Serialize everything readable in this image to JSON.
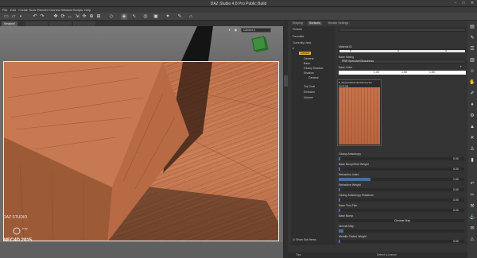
{
  "app": {
    "title": "DAZ Studio 4.8 Pro Public Build"
  },
  "menu": [
    "File",
    "Edit",
    "Create",
    "Tools",
    "Render",
    "Connect",
    "Window",
    "Scripts",
    "Help"
  ],
  "window_controls": [
    "minimize-icon",
    "maximize-icon",
    "close-icon"
  ],
  "toolbar": {
    "tools": [
      "new-icon",
      "open-icon",
      "save-icon",
      "undo-icon",
      "redo-icon",
      "pointer-icon",
      "universal-icon",
      "rotate-icon",
      "translate-icon",
      "scale-icon",
      "geometry-icon",
      "joint-icon",
      "node-icon",
      "region-icon",
      "surface-icon",
      "render-icon",
      "iray-icon",
      "spot-render-icon",
      "camera-icon",
      "light-icon"
    ]
  },
  "viewport": {
    "tab": "Viewport",
    "other_tabs": [
      "",
      "",
      ""
    ],
    "camera": "Camera 1",
    "logo": {
      "line1": "DAZ STUDIO",
      "line2": "",
      "iray": "Iray",
      "edition": "MEC4D 2015"
    }
  },
  "surfaces_panel": {
    "tabs": [
      "Shaping",
      "Surfaces",
      "Render Settings"
    ],
    "tree": {
      "items": [
        {
          "label": "Presets"
        },
        {
          "label": "Favorites"
        },
        {
          "label": "Currently Used"
        },
        {
          "label": "",
          "selected": false
        },
        {
          "label": "Default",
          "selected": true
        },
        {
          "label": "General"
        },
        {
          "label": "Base"
        },
        {
          "label": "Glossy Shadow"
        },
        {
          "label": "Shadow"
        },
        {
          "label": "General"
        },
        {
          "label": "Top Coat"
        },
        {
          "label": "Emission"
        },
        {
          "label": "Volume"
        }
      ],
      "checkbox_label": "Show Sub Items"
    },
    "props": {
      "header_label": "Material ID",
      "ids": [
        "0",
        "0",
        "0"
      ],
      "base_mixing_label": "Base Mixing",
      "base_mixing_value": "PBR Specular/Glossiness",
      "base_color_label": "Base Color",
      "base_color_values": [
        "1.00",
        "1.00",
        "1.00"
      ],
      "tooltip_title": "S_PlywoodSeamlessGlossyTex",
      "tooltip_file": "stone.jpg",
      "rows": [
        {
          "label": "Glossy Anisotropy",
          "value": "0.00"
        },
        {
          "label": "Base Bump/Mod Weight",
          "value": "0.00"
        },
        {
          "label": "Refraction Index",
          "value": "1.50"
        },
        {
          "label": "Refraction Weight",
          "value": "0.00"
        },
        {
          "label": "Glossy Anisotropy Rotations",
          "value": "0.00"
        },
        {
          "label": "Base Thin Film",
          "value": "0.00"
        },
        {
          "label": "Base Bump",
          "value": "Chrome Map"
        },
        {
          "label": "Normal Map",
          "value": ""
        },
        {
          "label": "Metallic Flakes Weight",
          "value": "0.00"
        }
      ]
    }
  },
  "statusbar": {
    "left": "Tips",
    "right": "Select a Lesson"
  },
  "right_tools": [
    "content-library-icon",
    "smart-content-icon",
    "scene-icon",
    "parameters-icon",
    "posing-icon",
    "shaping-icon",
    "surfaces-icon",
    "lights-icon",
    "cameras-icon",
    "render-icon",
    "undo-icon",
    "aux-icon",
    "tool-settings-icon",
    "timeline-icon",
    "search-icon",
    "lock-icon",
    "menu-icon"
  ]
}
